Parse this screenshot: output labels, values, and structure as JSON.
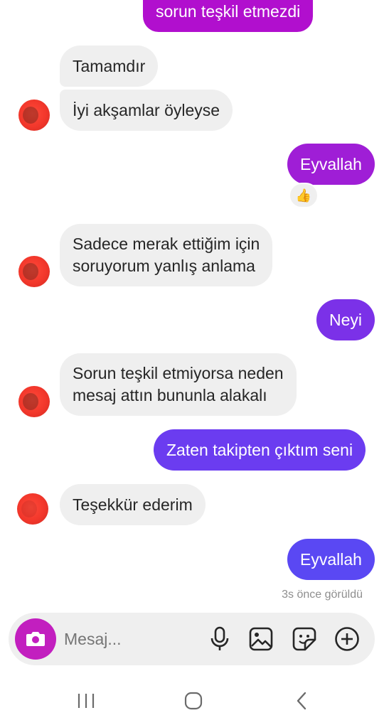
{
  "messages": [
    {
      "id": "m1",
      "dir": "out",
      "lines": [
        "sorun teşkil etmezdi"
      ],
      "color": "#b10fce"
    },
    {
      "id": "m2",
      "dir": "in",
      "lines": [
        "Tamamdır"
      ]
    },
    {
      "id": "m3",
      "dir": "in",
      "lines": [
        "İyi akşamlar öyleyse"
      ]
    },
    {
      "id": "m4",
      "dir": "out",
      "lines": [
        "Eyvallah"
      ],
      "color": "#9f1ed6",
      "reaction": "👍"
    },
    {
      "id": "m5",
      "dir": "in",
      "lines": [
        "Sadece merak ettiğim için",
        "soruyorum yanlış anlama"
      ]
    },
    {
      "id": "m6",
      "dir": "out",
      "lines": [
        "Neyi"
      ],
      "color": "#7b31e8"
    },
    {
      "id": "m7",
      "dir": "in",
      "lines": [
        "Sorun teşkil etmiyorsa neden",
        "mesaj attın bununla alakalı"
      ]
    },
    {
      "id": "m8",
      "dir": "out",
      "lines": [
        "Zaten takipten çıktım seni"
      ],
      "color": "#6b3cf0"
    },
    {
      "id": "m9",
      "dir": "in",
      "lines": [
        "Teşekkür ederim"
      ]
    },
    {
      "id": "m10",
      "dir": "out",
      "lines": [
        "Eyvallah"
      ],
      "color": "#5a48f3"
    }
  ],
  "seen_status": "3s önce görüldü",
  "composer": {
    "placeholder": "Mesaj...",
    "icons": [
      "camera-icon",
      "microphone-icon",
      "gallery-icon",
      "sticker-icon",
      "plus-icon"
    ],
    "camera_color": "#c21fbf"
  },
  "navbar": {
    "icons": [
      "recent-apps-icon",
      "home-icon",
      "back-icon"
    ]
  }
}
